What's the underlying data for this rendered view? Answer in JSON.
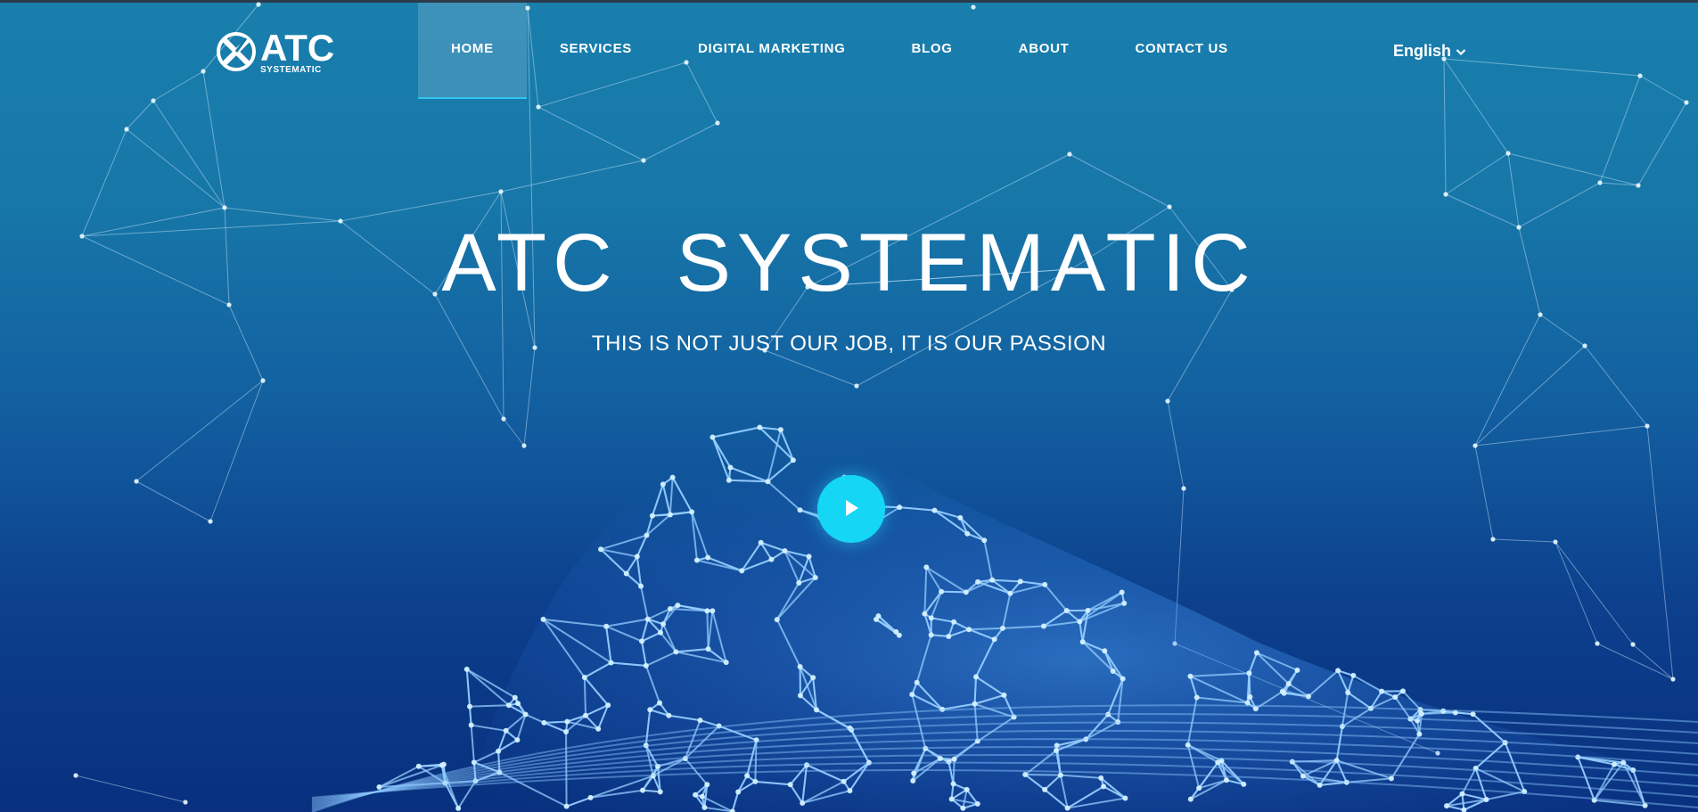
{
  "logo": {
    "brand": "ATC",
    "sub": "SYSTEMATIC"
  },
  "nav": {
    "items": [
      {
        "label": "HOME"
      },
      {
        "label": "SERVICES"
      },
      {
        "label": "DIGITAL MARKETING"
      },
      {
        "label": "BLOG"
      },
      {
        "label": "ABOUT"
      },
      {
        "label": "CONTACT US"
      }
    ],
    "active_index": 0
  },
  "language": {
    "label": "English",
    "icon": "chevron-down-icon"
  },
  "hero": {
    "title": "ATC  SYSTEMATIC",
    "subtitle": "THIS IS NOT JUST OUR JOB, IT IS OUR PASSION",
    "play_icon": "play-icon"
  },
  "colors": {
    "accent": "#16d6f5",
    "active_underline": "#2ec5f0",
    "bg_top": "#197fad",
    "bg_bottom": "#08307e"
  }
}
